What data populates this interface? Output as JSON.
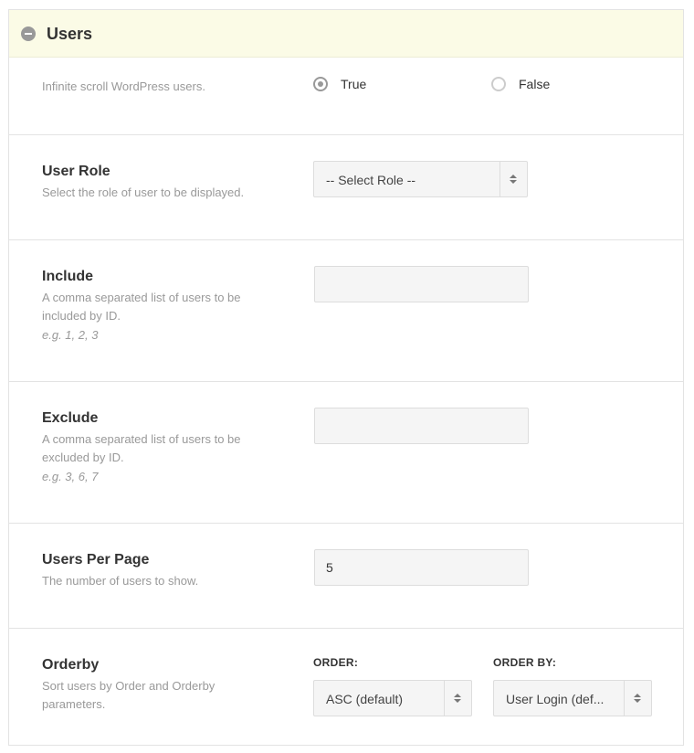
{
  "section": {
    "title": "Users",
    "toggle_icon": "minus-circle-icon"
  },
  "enable": {
    "description": "Infinite scroll WordPress users.",
    "options": [
      {
        "label": "True",
        "checked": true
      },
      {
        "label": "False",
        "checked": false
      }
    ]
  },
  "user_role": {
    "label": "User Role",
    "description": "Select the role of user to be displayed.",
    "selected": "-- Select Role --"
  },
  "include": {
    "label": "Include",
    "description": "A comma separated list of users to be included by ID.",
    "example": "e.g. 1, 2, 3",
    "value": ""
  },
  "exclude": {
    "label": "Exclude",
    "description": "A comma separated list of users to be excluded by ID.",
    "example": "e.g. 3, 6, 7",
    "value": ""
  },
  "per_page": {
    "label": "Users Per Page",
    "description": "The number of users to show.",
    "value": "5"
  },
  "orderby": {
    "label": "Orderby",
    "description": "Sort users by Order and Orderby parameters.",
    "order_label": "ORDER:",
    "order_value": "ASC (default)",
    "orderby_label": "ORDER BY:",
    "orderby_value": "User Login (def..."
  },
  "colors": {
    "header_bg": "#fbfbe6",
    "field_bg": "#f5f5f5",
    "muted_text": "#999999"
  }
}
